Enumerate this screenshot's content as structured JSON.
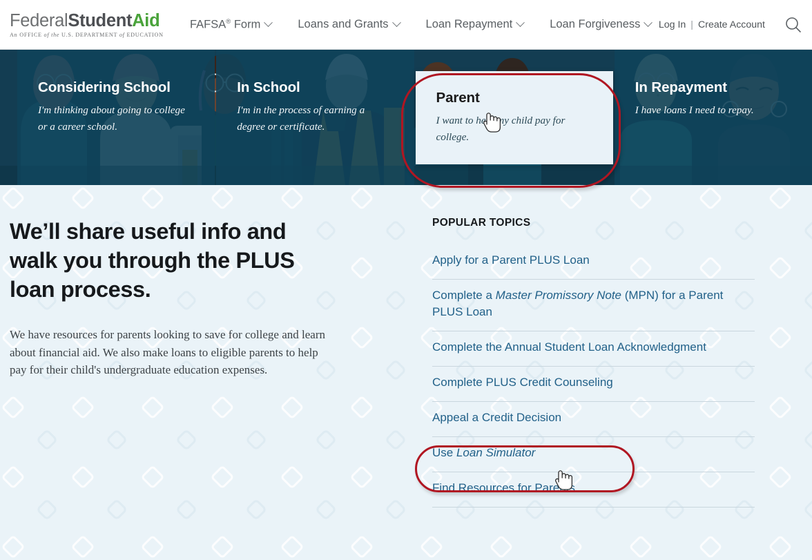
{
  "header": {
    "logo": {
      "part1": "Federal",
      "part2": "Student",
      "part3": "Aid",
      "tagline_pre": "An OFFICE ",
      "tagline_italic1": "of the",
      "tagline_mid": " U.S. DEPARTMENT ",
      "tagline_italic2": "of",
      "tagline_post": " EDUCATION"
    },
    "nav": [
      {
        "label": "FAFSA",
        "sup": "®",
        "label_tail": " Form",
        "has_caret": true
      },
      {
        "label": "Loans and Grants",
        "sup": "",
        "label_tail": "",
        "has_caret": true
      },
      {
        "label": "Loan Repayment",
        "sup": "",
        "label_tail": "",
        "has_caret": true
      },
      {
        "label": "Loan Forgiveness",
        "sup": "",
        "label_tail": "",
        "has_caret": true
      }
    ],
    "auth": {
      "login": "Log In",
      "separator": "|",
      "create_account": "Create Account"
    },
    "search_icon": "search-icon"
  },
  "hero": {
    "cards": [
      {
        "title": "Considering School",
        "subtitle": "I'm thinking about going to college or a career school.",
        "active": false
      },
      {
        "title": "In School",
        "subtitle": "I'm in the process of earning a degree or certificate.",
        "active": false
      },
      {
        "title": "Parent",
        "subtitle": "I want to help my child pay for college.",
        "active": true
      },
      {
        "title": "In Repayment",
        "subtitle": "I have loans I need to repay.",
        "active": false
      }
    ]
  },
  "main": {
    "lede": "We’ll share useful info and walk you through the PLUS loan process.",
    "body": "We have resources for parents looking to save for college and learn about financial aid. We also make loans to eligible parents to help pay for their child's undergraduate education expenses.",
    "topics_heading": "POPULAR TOPICS",
    "topics": [
      {
        "pre": "Apply for a Parent PLUS Loan",
        "italic": "",
        "post": ""
      },
      {
        "pre": "Complete a ",
        "italic": "Master Promissory Note",
        "post": " (MPN) for a Parent PLUS Loan"
      },
      {
        "pre": "Complete the Annual Student Loan Acknowledgment",
        "italic": "",
        "post": ""
      },
      {
        "pre": "Complete PLUS Credit Counseling",
        "italic": "",
        "post": ""
      },
      {
        "pre": "Appeal a Credit Decision",
        "italic": "",
        "post": ""
      },
      {
        "pre": "Use ",
        "italic": "Loan Simulator",
        "post": ""
      },
      {
        "pre": "Find Resources for Parents",
        "italic": "",
        "post": ""
      }
    ]
  },
  "annotations": {
    "highlight_parent_card": "Parent",
    "highlight_topic": "Appeal a Credit Decision",
    "color": "#b01622"
  },
  "colors": {
    "brand_green": "#4aa33b",
    "brand_gray": "#4d4f53",
    "hero_navy": "#0f425a",
    "page_bg": "#eaf3f8",
    "link_blue": "#226189",
    "annotation_red": "#b01622"
  }
}
